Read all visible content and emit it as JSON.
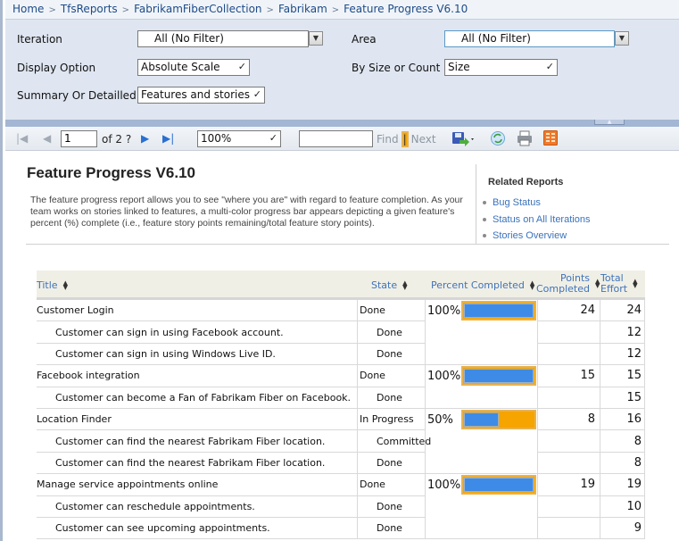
{
  "breadcrumb": [
    "Home",
    "TfsReports",
    "FabrikamFiberCollection",
    "Fabrikam",
    "Feature Progress V6.10"
  ],
  "params": {
    "iteration": {
      "label": "Iteration",
      "value": "All (No Filter)"
    },
    "area": {
      "label": "Area",
      "value": "All (No Filter)"
    },
    "display_option": {
      "label": "Display Option",
      "value": "Absolute Scale"
    },
    "by_size_or_count": {
      "label": "By Size or Count",
      "value": "Size"
    },
    "summary_or_detailled": {
      "label": "Summary Or Detailled",
      "value": "Features and stories"
    }
  },
  "toolbar": {
    "page": "1",
    "of_pages": "of 2 ?",
    "zoom": "100%",
    "find_value": "",
    "find_label": "Find",
    "separator": "|",
    "next_label": "Next",
    "icons": [
      "first-page-icon",
      "previous-page-icon",
      "next-page-icon",
      "last-page-icon",
      "export-icon",
      "refresh-icon",
      "print-icon",
      "document-map-icon"
    ]
  },
  "report": {
    "title": "Feature Progress V6.10",
    "description": "The feature progress report allows you to see \"where you are\" with regard to feature completion. As your team works on stories linked to features, a multi-color progress bar appears depicting a given feature's percent (%) complete (i.e., feature story points remaining/total feature story points).",
    "related": {
      "title": "Related Reports",
      "links": [
        "Bug Status",
        "Status on All Iterations",
        "Stories Overview"
      ]
    },
    "colors": {
      "progress_done": "#3d8be6",
      "progress_remaining": "#f5a400",
      "link": "#3a72bb"
    },
    "table": {
      "headers": {
        "title": "Title",
        "state": "State",
        "percent": "Percent Completed",
        "points_1": "Points",
        "points_2": "Completed",
        "total_1": "Total",
        "total_2": "Effort"
      },
      "rows": [
        {
          "type": "feature",
          "title": "Customer Login",
          "state": "Done",
          "percent": "100%",
          "progress": 1.0,
          "points": "24",
          "total": "24"
        },
        {
          "type": "story",
          "title": "Customer can sign in using Facebook account.",
          "state": "Done",
          "total": "12"
        },
        {
          "type": "story",
          "title": "Customer can sign in using Windows Live ID.",
          "state": "Done",
          "total": "12"
        },
        {
          "type": "feature",
          "title": "Facebook integration",
          "state": "Done",
          "percent": "100%",
          "progress": 1.0,
          "points": "15",
          "total": "15"
        },
        {
          "type": "story",
          "title": "Customer can become a Fan of Fabrikam Fiber on Facebook.",
          "state": "Done",
          "total": "15"
        },
        {
          "type": "feature",
          "title": "Location Finder",
          "state": "In Progress",
          "percent": "50%",
          "progress": 0.5,
          "points": "8",
          "total": "16"
        },
        {
          "type": "story",
          "title": "Customer can find the nearest Fabrikam Fiber location.",
          "state": "Committed",
          "total": "8"
        },
        {
          "type": "story",
          "title": "Customer can find the nearest Fabrikam Fiber location.",
          "state": "Done",
          "total": "8"
        },
        {
          "type": "feature",
          "title": "Manage service appointments online",
          "state": "Done",
          "percent": "100%",
          "progress": 1.0,
          "points": "19",
          "total": "19"
        },
        {
          "type": "story",
          "title": "Customer can reschedule appointments.",
          "state": "Done",
          "total": "10"
        },
        {
          "type": "story",
          "title": "Customer can see upcoming appointments.",
          "state": "Done",
          "total": "9"
        }
      ]
    }
  }
}
